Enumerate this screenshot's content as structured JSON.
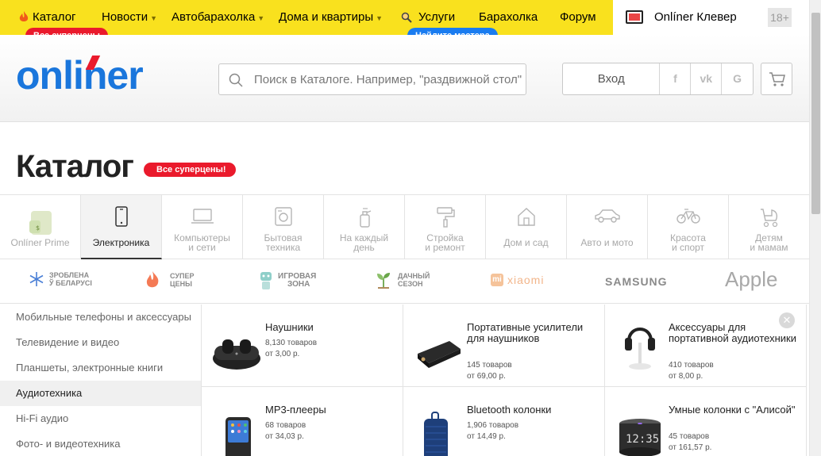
{
  "topnav": {
    "items": [
      {
        "label": "Каталог"
      },
      {
        "label": "Новости"
      },
      {
        "label": "Автобарахолка"
      },
      {
        "label": "Дома и квартиры"
      },
      {
        "label": "Услуги"
      },
      {
        "label": "Барахолка"
      },
      {
        "label": "Форум"
      }
    ],
    "promo_catalog": "Все суперцены",
    "promo_services": "Найдите мастера",
    "clever": "Onlíner Клевер",
    "age": "18+"
  },
  "header": {
    "logo": "onliner",
    "search_placeholder": "Поиск в Каталоге. Например, \"раздвижной стол\"",
    "login": "Вход",
    "social": [
      "f",
      "vk",
      "G"
    ]
  },
  "page": {
    "title": "Каталог",
    "badge": "Все суперцены!"
  },
  "categories": [
    {
      "line1": "Onlíner Prime",
      "line2": ""
    },
    {
      "line1": "Электроника",
      "line2": ""
    },
    {
      "line1": "Компьютеры",
      "line2": "и сети"
    },
    {
      "line1": "Бытовая",
      "line2": "техника"
    },
    {
      "line1": "На каждый",
      "line2": "день"
    },
    {
      "line1": "Стройка",
      "line2": "и ремонт"
    },
    {
      "line1": "Дом и сад",
      "line2": ""
    },
    {
      "line1": "Авто и мото",
      "line2": ""
    },
    {
      "line1": "Красота",
      "line2": "и спорт"
    },
    {
      "line1": "Детям",
      "line2": "и мамам"
    }
  ],
  "brands": [
    {
      "line1": "ЗРОБЛЕНА",
      "line2": "Ў БЕЛАРУСІ"
    },
    {
      "line1": "СУПЕР",
      "line2": "ЦЕНЫ"
    },
    {
      "line1": "ИГРОВАЯ",
      "line2": "ЗОНА"
    },
    {
      "line1": "ДАЧНЫЙ",
      "line2": "СЕЗОН"
    },
    {
      "label": "xiaomi"
    },
    {
      "label": "SAMSUNG"
    },
    {
      "label": "Apple"
    }
  ],
  "sidebar": [
    "Мобильные телефоны и аксессуары",
    "Телевидение и видео",
    "Планшеты, электронные книги",
    "Аудиотехника",
    "Hi-Fi аудио",
    "Фото- и видеотехника"
  ],
  "products": [
    {
      "name": "Наушники",
      "count": "8,130 товаров",
      "price": "от 3,00 р."
    },
    {
      "name": "Портативные усилители для наушников",
      "count": "145 товаров",
      "price": "от 69,00 р."
    },
    {
      "name": "Аксессуары для портативной аудиотехники",
      "count": "410 товаров",
      "price": "от 8,00 р."
    },
    {
      "name": "MP3-плееры",
      "count": "68 товаров",
      "price": "от 34,03 р."
    },
    {
      "name": "Bluetooth колонки",
      "count": "1,906 товаров",
      "price": "от 14,49 р."
    },
    {
      "name": "Умные колонки с \"Алисой\"",
      "count": "45 товаров",
      "price": "от 161,57 р."
    }
  ],
  "clock_text": "12:35",
  "colors": {
    "brand": "#1a76dc",
    "accent_red": "#ea1a2c",
    "nav_yellow": "#f9e11e",
    "promo_blue": "#1a7cf0"
  }
}
